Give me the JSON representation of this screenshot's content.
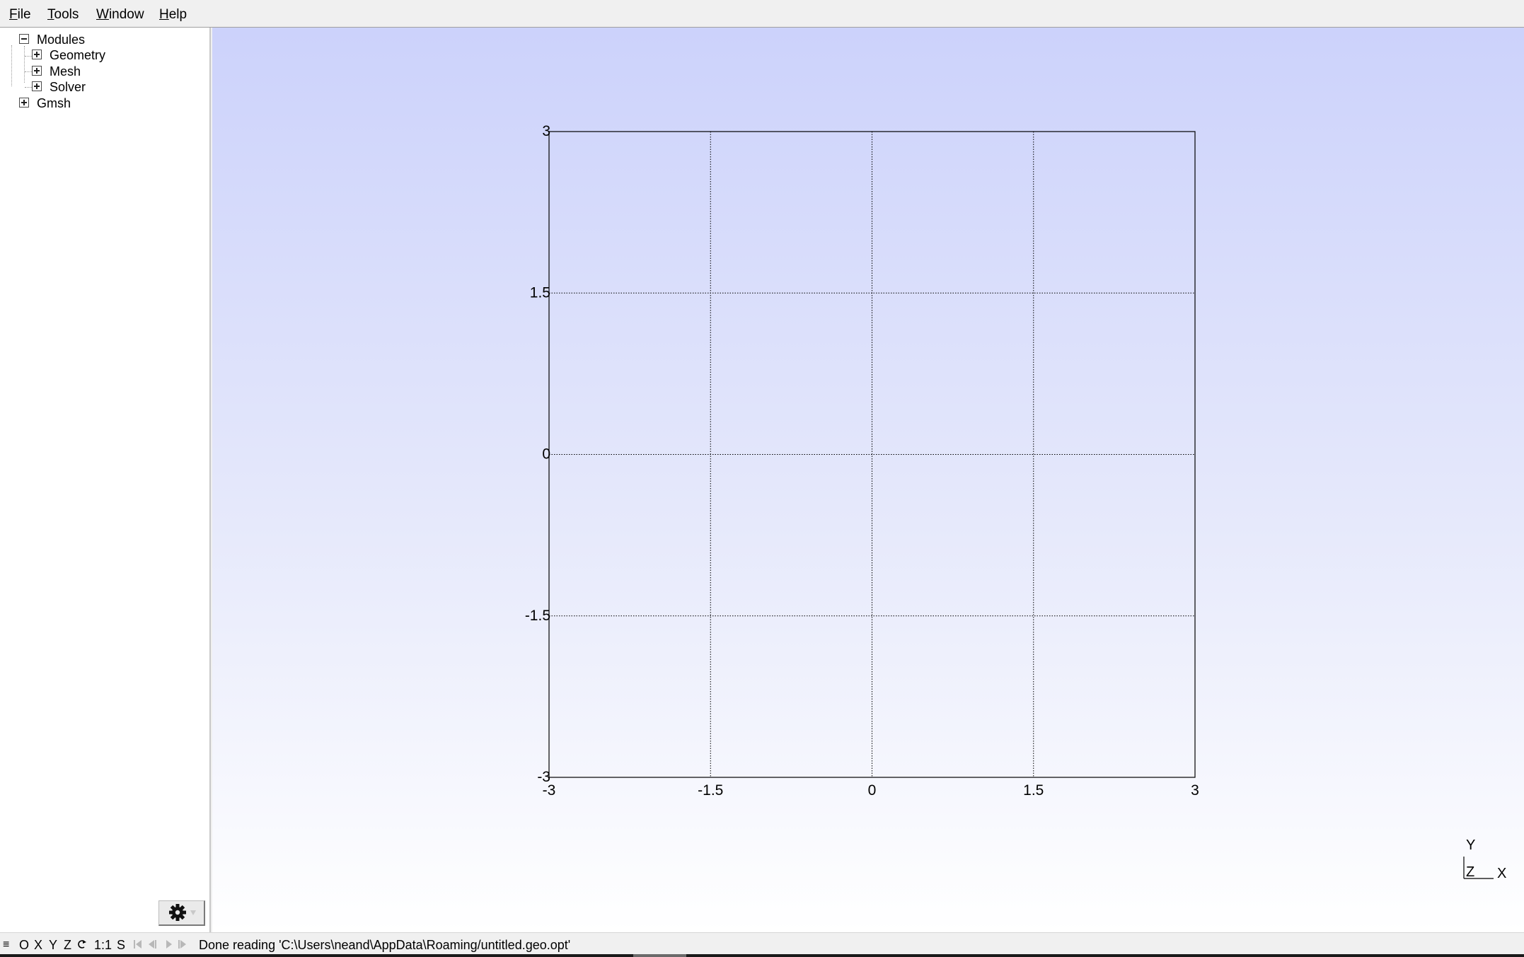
{
  "menu": {
    "file": {
      "acc": "F",
      "rest": "ile"
    },
    "tools": {
      "acc": "T",
      "rest": "ools"
    },
    "window": {
      "acc": "W",
      "rest": "indow"
    },
    "help": {
      "acc": "H",
      "rest": "elp"
    }
  },
  "tree": {
    "modules": {
      "label": "Modules",
      "state": "expanded"
    },
    "geometry": {
      "label": "Geometry",
      "state": "collapsed"
    },
    "mesh": {
      "label": "Mesh",
      "state": "collapsed"
    },
    "solver": {
      "label": "Solver",
      "state": "collapsed"
    },
    "gmsh": {
      "label": "Gmsh",
      "state": "collapsed"
    }
  },
  "sidebar": {
    "settings_icon": "gear-icon",
    "dropdown_icon": "triangle-down-icon"
  },
  "status": {
    "buttons": {
      "menu": "≡",
      "origin": "O",
      "x": "X",
      "y": "Y",
      "z": "Z",
      "rotate_icon": "rotate-icon",
      "scale": "1:1",
      "s": "S"
    },
    "message": "Done reading 'C:\\Users\\neand\\AppData\\Roaming/untitled.geo.opt'"
  },
  "chart_data": {
    "type": "scatter",
    "title": "",
    "xlabel": "",
    "ylabel": "",
    "xlim": [
      -3,
      3
    ],
    "ylim": [
      -3,
      3
    ],
    "x_ticks": [
      "-3",
      "-1.5",
      "0",
      "1.5",
      "3"
    ],
    "y_ticks": [
      "3",
      "1.5",
      "0",
      "-1.5",
      "-3"
    ],
    "grid": true,
    "series": []
  },
  "axes_triad": {
    "y": "Y",
    "z": "Z",
    "x": "X"
  },
  "colors": {
    "background_top": "#ccd2fb",
    "background_bottom": "#ffffff",
    "axis": "#000000",
    "grid": "#000000"
  }
}
